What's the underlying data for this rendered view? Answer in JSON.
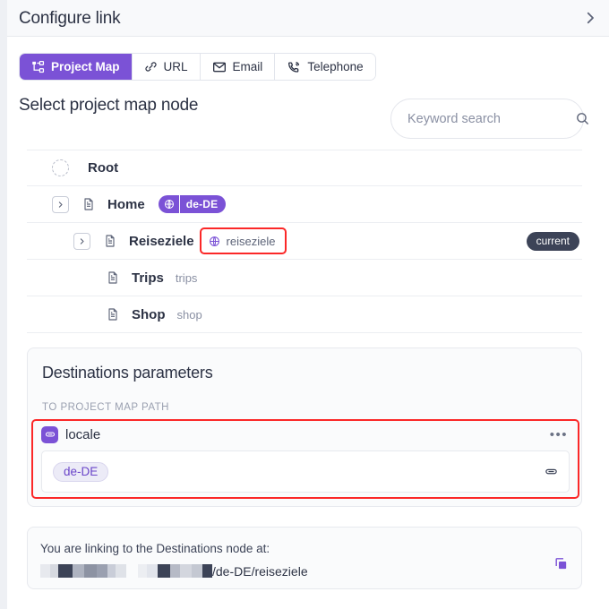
{
  "header": {
    "title": "Configure link",
    "collapse_icon": "chevron-right-icon"
  },
  "tabs": [
    {
      "label": "Project Map",
      "icon": "sitemap-icon",
      "active": true
    },
    {
      "label": "URL",
      "icon": "link-icon",
      "active": false
    },
    {
      "label": "Email",
      "icon": "envelope-icon",
      "active": false
    },
    {
      "label": "Telephone",
      "icon": "phone-ring-icon",
      "active": false
    }
  ],
  "select_section": {
    "title": "Select project map node",
    "search_placeholder": "Keyword search",
    "search_value": "",
    "search_icon": "search-icon"
  },
  "tree": [
    {
      "name": "Root",
      "indent": 0,
      "has_twisty": false,
      "icon": "dashed-circle-icon",
      "slug": "",
      "slug_style": "none",
      "badge": "",
      "highlighted": false
    },
    {
      "name": "Home",
      "indent": 1,
      "has_twisty": true,
      "icon": "document-icon",
      "slug": "de-DE",
      "slug_style": "locale-badge",
      "badge": "",
      "highlighted": false
    },
    {
      "name": "Reiseziele",
      "indent": 2,
      "has_twisty": true,
      "icon": "document-icon",
      "slug": "reiseziele",
      "slug_style": "slug-chip",
      "badge": "current",
      "highlighted": true
    },
    {
      "name": "Trips",
      "indent": 3,
      "has_twisty": false,
      "icon": "document-icon",
      "slug": "trips",
      "slug_style": "plain",
      "badge": "",
      "highlighted": false
    },
    {
      "name": "Shop",
      "indent": 3,
      "has_twisty": false,
      "icon": "document-icon",
      "slug": "shop",
      "slug_style": "plain",
      "badge": "",
      "highlighted": false
    }
  ],
  "params": {
    "title": "Destinations parameters",
    "subtitle": "TO PROJECT MAP PATH",
    "param_name": "locale",
    "param_icon": "token-icon",
    "menu_icon": "ellipsis-icon",
    "menu_label": "•••",
    "value_token": "de-DE",
    "field_end_icon": "token-icon"
  },
  "link_info": {
    "label": "You are linking to the Destinations node at:",
    "url_suffix": "/de-DE/reiseziele",
    "copy_icon": "copy-icon",
    "redacted_block_1": [
      "#e7e9ee",
      "#d6d9e0",
      "#3c4357",
      "#aeb3c0",
      "#8d93a3",
      "#9aa0b0",
      "#c9cdd8",
      "#dfe2e8"
    ],
    "redacted_block_2": [
      "#eceef2",
      "#e2e5ec",
      "#3c4357",
      "#b6bac6",
      "#d3d6de",
      "#c4c8d2",
      "#3c4357"
    ]
  },
  "colors": {
    "accent": "#7b52d6",
    "highlight": "#fb2828",
    "badge_dark": "#3c4357",
    "text": "#2c3244",
    "muted": "#8a90a3"
  }
}
